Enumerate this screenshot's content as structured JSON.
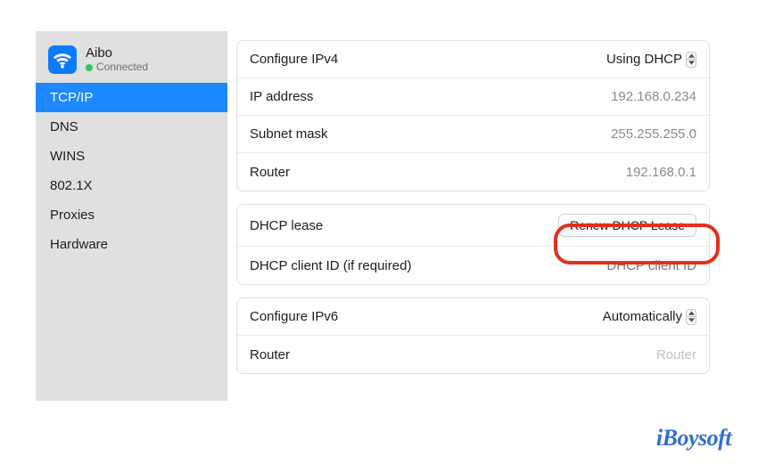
{
  "network": {
    "name": "Aibo",
    "status": "Connected",
    "status_color": "#34c759"
  },
  "sidebar": {
    "items": [
      {
        "label": "TCP/IP",
        "selected": true
      },
      {
        "label": "DNS"
      },
      {
        "label": "WINS"
      },
      {
        "label": "802.1X"
      },
      {
        "label": "Proxies"
      },
      {
        "label": "Hardware"
      }
    ]
  },
  "group1": {
    "configure_ipv4": {
      "label": "Configure IPv4",
      "value": "Using DHCP"
    },
    "ip_address": {
      "label": "IP address",
      "value": "192.168.0.234"
    },
    "subnet_mask": {
      "label": "Subnet mask",
      "value": "255.255.255.0"
    },
    "router": {
      "label": "Router",
      "value": "192.168.0.1"
    }
  },
  "group2": {
    "dhcp_lease": {
      "label": "DHCP lease",
      "button": "Renew DHCP Lease"
    },
    "dhcp_client_id": {
      "label": "DHCP client ID (if required)",
      "placeholder": "DHCP client ID"
    }
  },
  "group3": {
    "configure_ipv6": {
      "label": "Configure IPv6",
      "value": "Automatically"
    },
    "router": {
      "label": "Router",
      "placeholder": "Router"
    }
  },
  "watermark": "iBoysoft"
}
